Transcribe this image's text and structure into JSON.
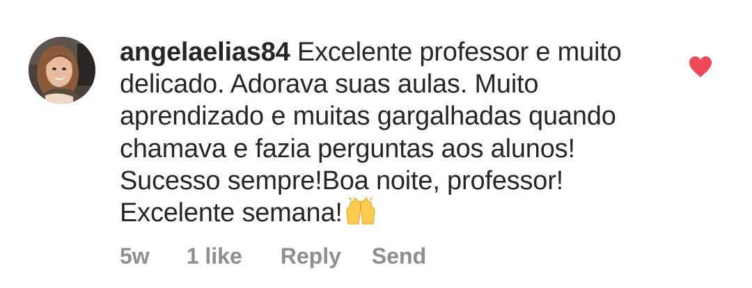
{
  "comment": {
    "username": "angelaelias84",
    "lines": [
      " Excelente professor e muito",
      "delicado. Adorava suas aulas.  Muito",
      "aprendizado e muitas gargalhadas quando",
      "chamava e fazia perguntas aos alunos!",
      "Sucesso sempre!Boa noite, professor!",
      "Excelente semana!"
    ],
    "emoji": "raising-hands-emoji",
    "liked": true,
    "heart_color": "#ed4956",
    "meta": {
      "time": "5w",
      "likes": "1 like",
      "reply": "Reply",
      "send": "Send"
    }
  },
  "colors": {
    "text": "#262626",
    "meta": "#8e8e8e",
    "background": "#ffffff"
  }
}
